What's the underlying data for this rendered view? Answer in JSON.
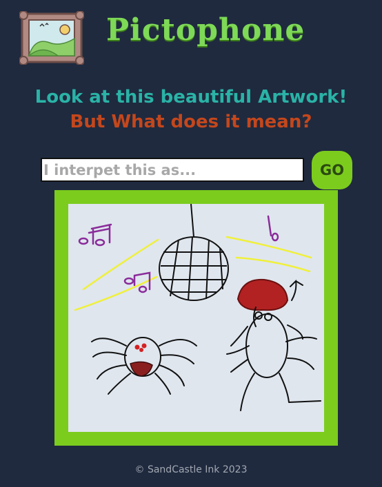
{
  "app": {
    "title": "Pictophone",
    "logo_icon": "framed-picture-icon"
  },
  "prompt": {
    "line1": "Look at this beautiful Artwork!",
    "line2": "But What does it mean?"
  },
  "guess": {
    "value": "",
    "placeholder": "I interpet this as...",
    "submit_label": "GO"
  },
  "artwork": {
    "icons": [
      "music-note-icon",
      "disco-ball-icon",
      "spider-icon",
      "spider-with-hat-icon"
    ]
  },
  "footer": {
    "copyright": "© SandCastle Ink 2023"
  },
  "colors": {
    "background": "#1f2a3f",
    "title": "#7ed957",
    "prompt_line1": "#2ab3a6",
    "prompt_line2": "#c4471c",
    "accent": "#7ccc1e",
    "canvas": "#dfe6ee"
  }
}
